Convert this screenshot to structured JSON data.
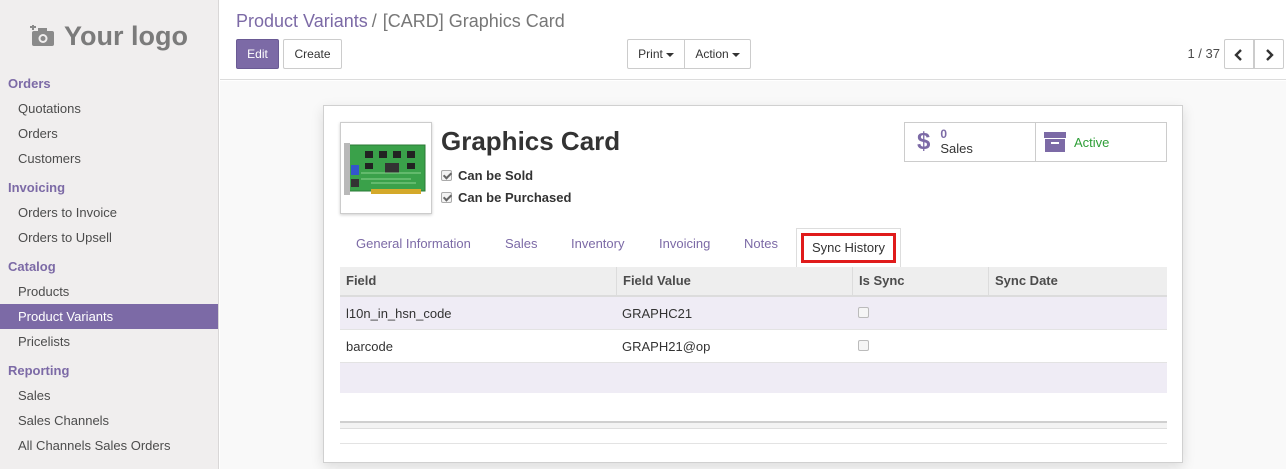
{
  "logo": {
    "text": "Your logo",
    "icon": "camera-plus-icon"
  },
  "sidebar": {
    "sections": [
      {
        "title": "Orders",
        "items": [
          "Quotations",
          "Orders",
          "Customers"
        ]
      },
      {
        "title": "Invoicing",
        "items": [
          "Orders to Invoice",
          "Orders to Upsell"
        ]
      },
      {
        "title": "Catalog",
        "items": [
          "Products",
          "Product Variants",
          "Pricelists"
        ]
      },
      {
        "title": "Reporting",
        "items": [
          "Sales",
          "Sales Channels",
          "All Channels Sales Orders"
        ]
      }
    ],
    "active_item": "Product Variants"
  },
  "breadcrumb": {
    "parent": "Product Variants",
    "separator": "/",
    "current": "[CARD] Graphics Card"
  },
  "toolbar": {
    "edit_label": "Edit",
    "create_label": "Create",
    "print_label": "Print",
    "action_label": "Action"
  },
  "pager": {
    "value": "1 / 37",
    "prev_icon": "chevron-left-icon",
    "next_icon": "chevron-right-icon"
  },
  "product": {
    "name": "Graphics Card",
    "can_be_sold_label": "Can be Sold",
    "can_be_sold": true,
    "can_be_purchased_label": "Can be Purchased",
    "can_be_purchased": true
  },
  "stats": {
    "sales_count": "0",
    "sales_label": "Sales",
    "sales_icon": "dollar-icon",
    "active_label": "Active",
    "active_icon": "archive-icon"
  },
  "tabs": [
    "General Information",
    "Sales",
    "Inventory",
    "Invoicing",
    "Notes",
    "Sync History"
  ],
  "active_tab": "Sync History",
  "sync_table": {
    "columns": [
      "Field",
      "Field Value",
      "Is Sync",
      "Sync Date"
    ],
    "rows": [
      {
        "field": "l10n_in_hsn_code",
        "value": "GRAPHC21",
        "is_sync": false,
        "date": ""
      },
      {
        "field": "barcode",
        "value": "GRAPH21@op",
        "is_sync": false,
        "date": ""
      }
    ]
  },
  "colors": {
    "brand": "#7c6aa6",
    "active_green": "#2e9e37",
    "highlight_red": "#e01b1b"
  }
}
